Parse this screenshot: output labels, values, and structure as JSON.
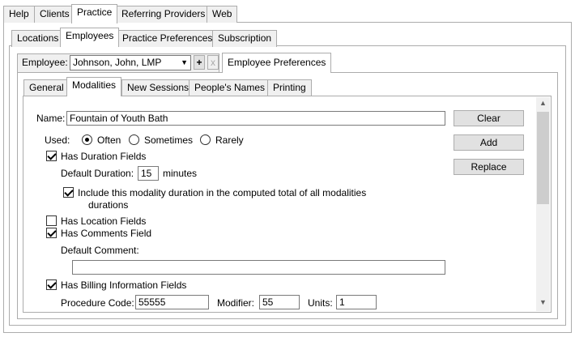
{
  "main_tabs": [
    "Help",
    "Clients",
    "Practice",
    "Referring Providers",
    "Web"
  ],
  "practice_tabs": [
    "Locations",
    "Employees",
    "Practice Preferences",
    "Subscription"
  ],
  "employee": {
    "label": "Employee:",
    "selected": "Johnson, John, LMP",
    "add_label": "+",
    "remove_label": "x",
    "pref_tab": "Employee Preferences"
  },
  "pref_tabs": [
    "General",
    "Modalities",
    "New Sessions",
    "People's Names",
    "Printing"
  ],
  "form": {
    "name_label": "Name:",
    "name_value": "Fountain of Youth Bath",
    "used_label": "Used:",
    "used_options": [
      "Often",
      "Sometimes",
      "Rarely"
    ],
    "has_duration": "Has Duration Fields",
    "default_duration_label": "Default Duration:",
    "default_duration_value": "15",
    "minutes": "minutes",
    "include_line1": "Include this modality duration in the computed total of all modalities",
    "include_line2": "durations",
    "has_location": "Has Location Fields",
    "has_comments": "Has Comments Field",
    "default_comment_label": "Default Comment:",
    "default_comment_value": "",
    "has_billing": "Has Billing Information Fields",
    "procedure_label": "Procedure Code:",
    "procedure_value": "55555",
    "modifier_label": "Modifier:",
    "modifier_value": "55",
    "units_label": "Units:",
    "units_value": "1"
  },
  "actions": {
    "clear": "Clear",
    "add": "Add",
    "replace": "Replace"
  }
}
